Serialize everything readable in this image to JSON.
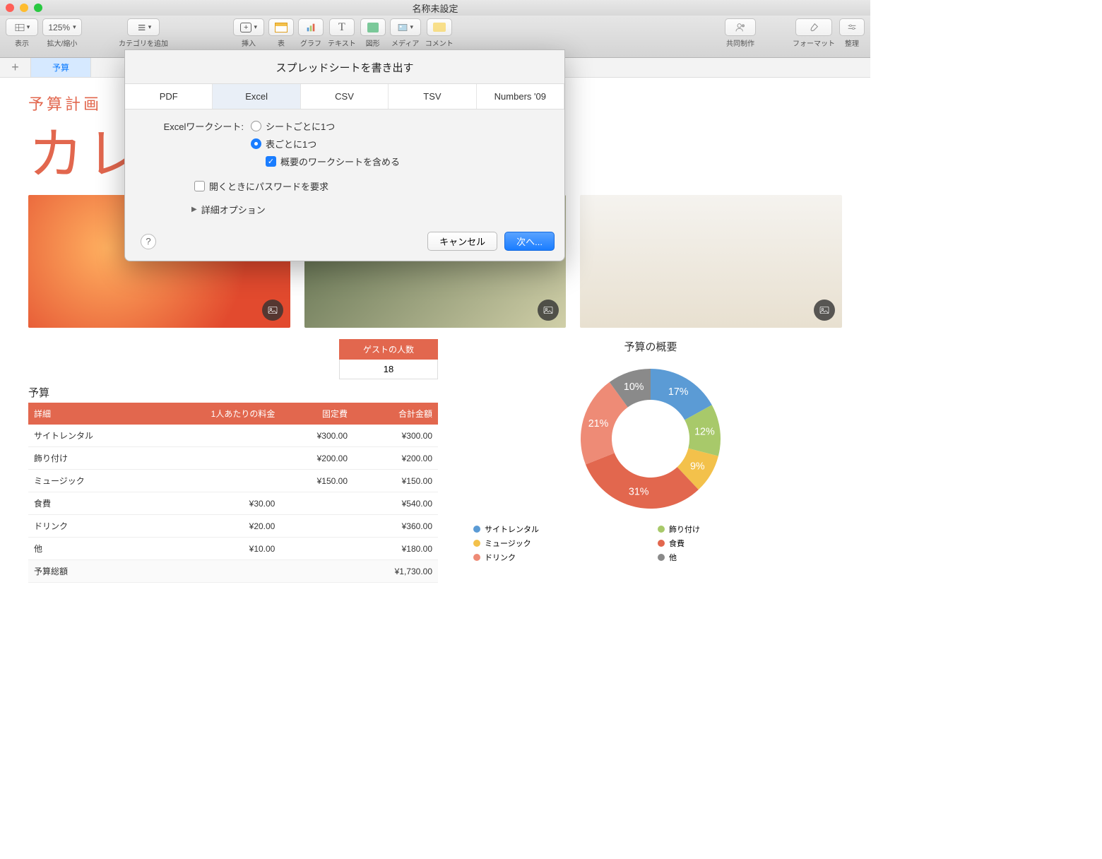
{
  "window": {
    "title": "名称未設定"
  },
  "toolbar": {
    "view": "表示",
    "zoom": "拡大/縮小",
    "zoom_value": "125%",
    "category": "カテゴリを追加",
    "insert": "挿入",
    "table": "表",
    "chart": "グラフ",
    "text": "テキスト",
    "shape": "図形",
    "media": "メディア",
    "comment": "コメント",
    "collaborate": "共同制作",
    "format": "フォーマット",
    "organize": "整理"
  },
  "sheet_tab": "予算",
  "doc": {
    "subtitle": "予算計画",
    "title": "カレ"
  },
  "guest": {
    "label": "ゲストの人数",
    "value": "18"
  },
  "budget": {
    "title": "予算",
    "headers": [
      "詳細",
      "1人あたりの料金",
      "固定費",
      "合計金額"
    ],
    "rows": [
      [
        "サイトレンタル",
        "",
        "¥300.00",
        "¥300.00"
      ],
      [
        "飾り付け",
        "",
        "¥200.00",
        "¥200.00"
      ],
      [
        "ミュージック",
        "",
        "¥150.00",
        "¥150.00"
      ],
      [
        "食費",
        "¥30.00",
        "",
        "¥540.00"
      ],
      [
        "ドリンク",
        "¥20.00",
        "",
        "¥360.00"
      ],
      [
        "他",
        "¥10.00",
        "",
        "¥180.00"
      ]
    ],
    "total_label": "予算総額",
    "total_value": "¥1,730.00"
  },
  "chart_data": {
    "type": "pie",
    "title": "予算の概要",
    "series": [
      {
        "name": "サイトレンタル",
        "value": 17,
        "color": "#5b9bd5"
      },
      {
        "name": "飾り付け",
        "value": 12,
        "color": "#a8c96a"
      },
      {
        "name": "ミュージック",
        "value": 9,
        "color": "#f3c14b"
      },
      {
        "name": "食費",
        "value": 31,
        "color": "#e2674e"
      },
      {
        "name": "ドリンク",
        "value": 21,
        "color": "#ee8b76"
      },
      {
        "name": "他",
        "value": 10,
        "color": "#8a8a8a"
      }
    ]
  },
  "modal": {
    "title": "スプレッドシートを書き出す",
    "tabs": [
      "PDF",
      "Excel",
      "CSV",
      "TSV",
      "Numbers '09"
    ],
    "active_tab": "Excel",
    "worksheet_label": "Excelワークシート:",
    "opt_per_sheet": "シートごとに1つ",
    "opt_per_table": "表ごとに1つ",
    "include_summary": "概要のワークシートを含める",
    "require_password": "開くときにパスワードを要求",
    "advanced": "詳細オプション",
    "cancel": "キャンセル",
    "next": "次へ..."
  }
}
